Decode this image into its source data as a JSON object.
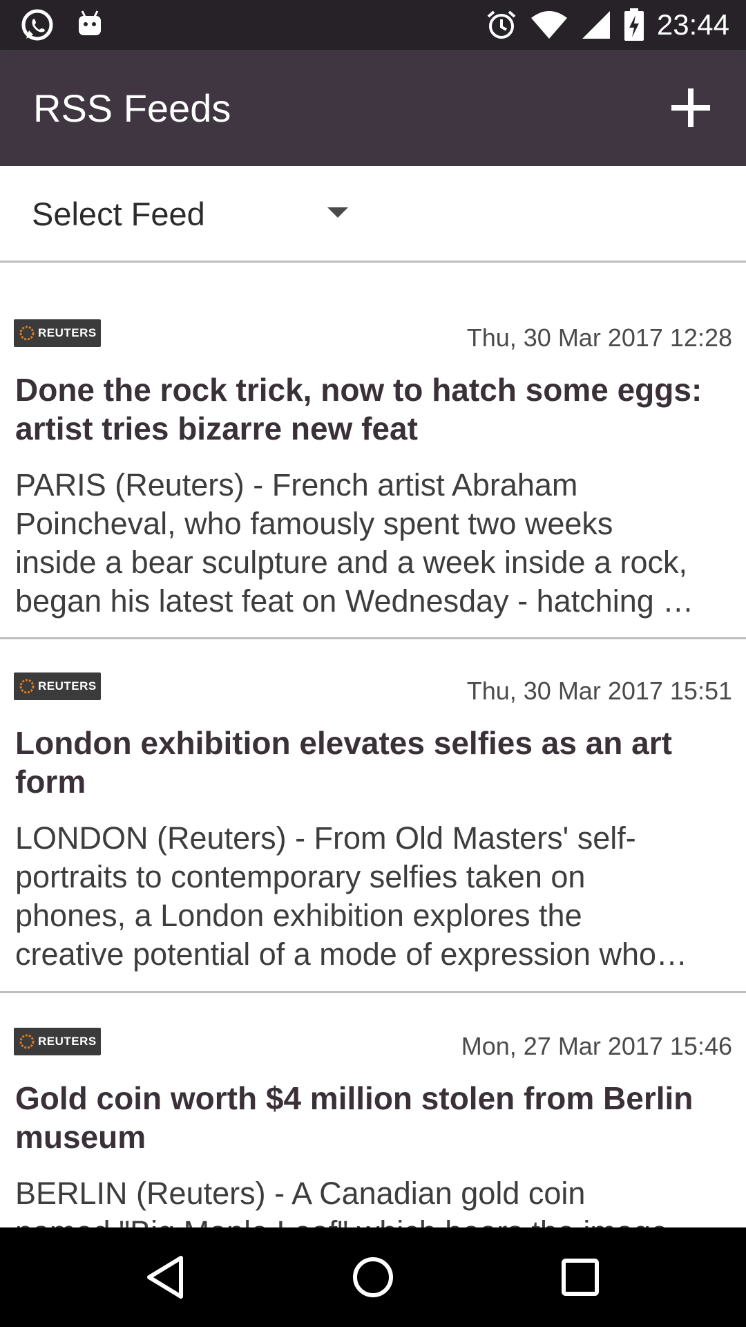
{
  "status_bar": {
    "time": "23:44",
    "icons": [
      "whatsapp-icon",
      "android-icon",
      "alarm-icon",
      "wifi-icon",
      "signal-icon",
      "battery-charging-icon"
    ]
  },
  "app_bar": {
    "title": "RSS Feeds",
    "add_icon": "plus-icon"
  },
  "feed_selector": {
    "label": "Select Feed"
  },
  "articles": [
    {
      "source": "REUTERS",
      "date": "Thu, 30 Mar 2017 12:28",
      "title_lines": [
        "Done the rock trick, now to hatch some eggs:",
        "artist tries bizarre new feat"
      ],
      "desc_lines": [
        "PARIS (Reuters) - French artist Abraham",
        "Poincheval, who famously spent two weeks",
        "inside a bear sculpture and a week inside a rock,",
        "began his latest feat on Wednesday - hatching …"
      ]
    },
    {
      "source": "REUTERS",
      "date": "Thu, 30 Mar 2017 15:51",
      "title_lines": [
        "London exhibition elevates selfies as an art",
        "form"
      ],
      "desc_lines": [
        "LONDON (Reuters) - From Old Masters' self-",
        "portraits to contemporary selfies taken on",
        "phones, a London exhibition explores the",
        "creative potential of a mode of expression who…"
      ]
    },
    {
      "source": "REUTERS",
      "date": "Mon, 27 Mar 2017 15:46",
      "title_lines": [
        "Gold coin worth $4 million stolen from Berlin",
        "museum"
      ],
      "desc_lines": [
        "BERLIN (Reuters) - A Canadian gold coin",
        "named \"Big Maple Leaf\" which bears the image"
      ]
    }
  ],
  "nav_bar": {
    "icons": [
      "back-icon",
      "home-icon",
      "recents-icon"
    ]
  }
}
